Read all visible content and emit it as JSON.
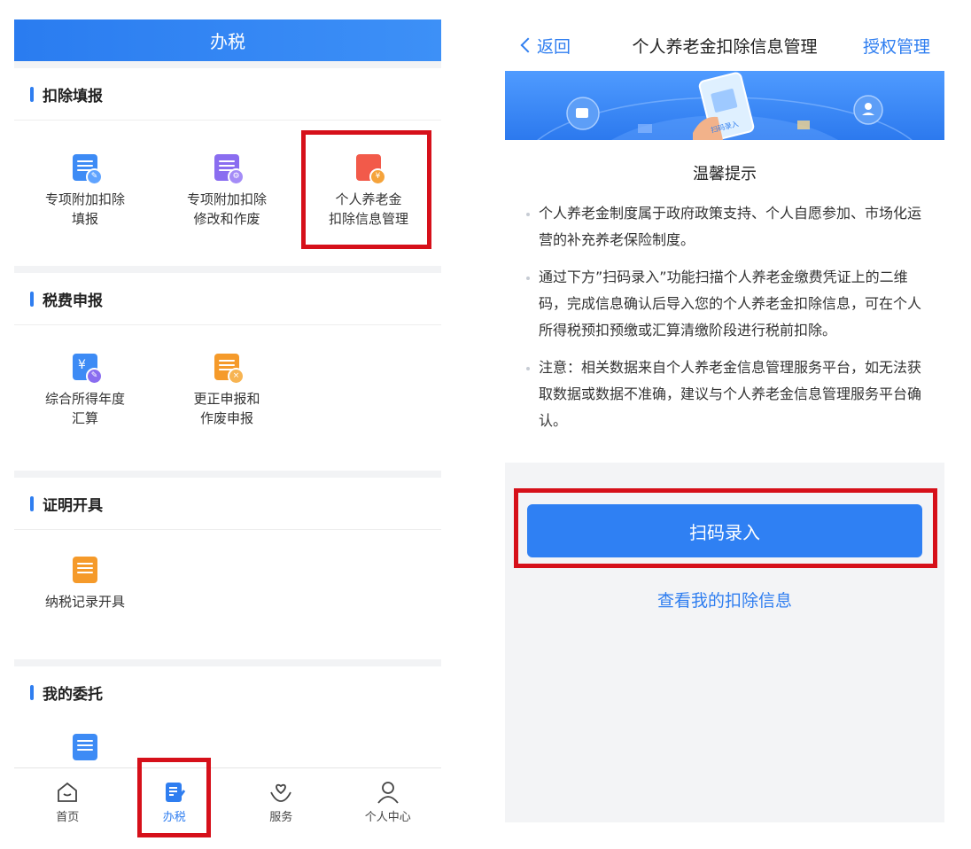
{
  "left": {
    "header_title": "办税",
    "sections": [
      {
        "title": "扣除填报",
        "items": [
          {
            "label_line1": "专项附加扣除",
            "label_line2": "填报",
            "icon": "form-edit-icon",
            "color": "#3d8bf5"
          },
          {
            "label_line1": "专项附加扣除",
            "label_line2": "修改和作废",
            "icon": "form-settings-icon",
            "color": "#8a6df0"
          },
          {
            "label_line1": "个人养老金",
            "label_line2": "扣除信息管理",
            "icon": "pension-card-icon",
            "color": "#f25a4a"
          }
        ]
      },
      {
        "title": "税费申报",
        "items": [
          {
            "label_line1": "综合所得年度",
            "label_line2": "汇算",
            "icon": "yuan-doc-icon",
            "color": "#3d8bf5"
          },
          {
            "label_line1": "更正申报和",
            "label_line2": "作废申报",
            "icon": "cancel-doc-icon",
            "color": "#f59a2a"
          }
        ]
      },
      {
        "title": "证明开具",
        "items": [
          {
            "label_line1": "纳税记录开具",
            "label_line2": "",
            "icon": "record-doc-icon",
            "color": "#f59a2a"
          }
        ]
      },
      {
        "title": "我的委托",
        "items": [
          {
            "label_line1": "",
            "label_line2": "",
            "icon": "delegate-doc-icon",
            "color": "#3d8bf5"
          }
        ]
      }
    ],
    "tabs": [
      {
        "label": "首页",
        "icon": "home-icon",
        "active": false
      },
      {
        "label": "办税",
        "icon": "tax-edit-icon",
        "active": true
      },
      {
        "label": "服务",
        "icon": "service-heart-icon",
        "active": false
      },
      {
        "label": "个人中心",
        "icon": "user-icon",
        "active": false
      }
    ]
  },
  "right": {
    "back_label": "返回",
    "title": "个人养老金扣除信息管理",
    "auth_label": "授权管理",
    "banner_caption": "扫码录入",
    "tip_title": "温馨提示",
    "tips": [
      "个人养老金制度属于政府政策支持、个人自愿参加、市场化运营的补充养老保险制度。",
      "通过下方”扫码录入”功能扫描个人养老金缴费凭证上的二维码，完成信息确认后导入您的个人养老金扣除信息，可在个人所得税预扣预缴或汇算清缴阶段进行税前扣除。",
      "注意：相关数据来自个人养老金信息管理服务平台，如无法获取数据或数据不准确，建议与个人养老金信息管理服务平台确认。"
    ],
    "scan_button": "扫码录入",
    "view_link": "查看我的扣除信息"
  },
  "colors": {
    "accent": "#2f7ef0",
    "highlight": "#d6101a"
  }
}
